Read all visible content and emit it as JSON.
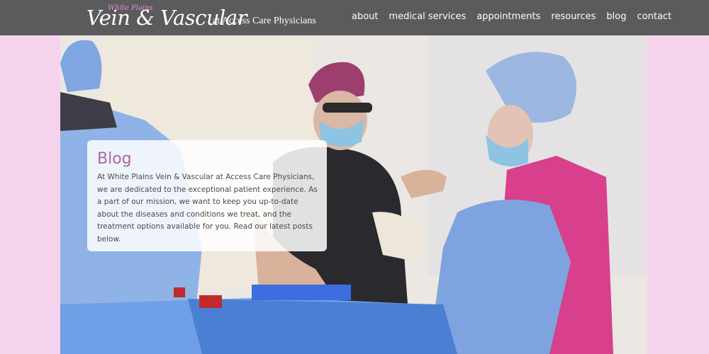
{
  "header": {
    "logo": {
      "small_text": "White Plains",
      "script_text": "Vein",
      "amp": "&",
      "script_text_2": "Vascular",
      "suffix": "at Access Care Physicians"
    },
    "nav": [
      {
        "label": "about"
      },
      {
        "label": "medical services"
      },
      {
        "label": "appointments"
      },
      {
        "label": "resources"
      },
      {
        "label": "blog"
      },
      {
        "label": "contact"
      }
    ]
  },
  "hero": {
    "image_icon": "surgery-photo",
    "panel": {
      "title": "Blog",
      "body": "At White Plains Vein & Vascular at Access Care Physicians, we are dedicated to the exceptional patient experience. As a part of our mission, we want to keep you up-to-date about the diseases and conditions we treat, and the treatment options available for you. Read our latest posts below."
    }
  },
  "colors": {
    "background": "#f5d3ec",
    "header": "#5b5a5c",
    "accent": "#b0659f"
  }
}
